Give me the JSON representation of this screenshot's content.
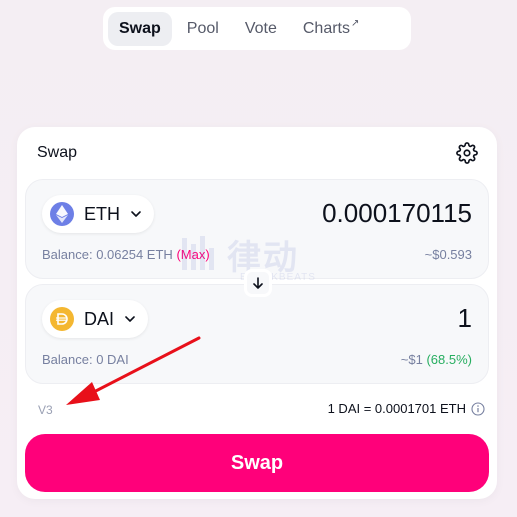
{
  "nav": {
    "items": [
      {
        "label": "Swap",
        "active": true
      },
      {
        "label": "Pool",
        "active": false
      },
      {
        "label": "Vote",
        "active": false
      },
      {
        "label": "Charts",
        "active": false,
        "external_mark": "↗"
      }
    ]
  },
  "card": {
    "title": "Swap",
    "settings_icon": "gear-icon",
    "from": {
      "token": "ETH",
      "amount": "0.000170115",
      "balance": "Balance: 0.06254 ETH",
      "max_label": "(Max)",
      "usd": "~$0.593"
    },
    "to": {
      "token": "DAI",
      "amount": "1",
      "balance": "Balance: 0 DAI",
      "usd": "~$1",
      "usd_pct": "(68.5%)"
    },
    "version": "V3",
    "rate": "1 DAI = 0.0001701 ETH",
    "swap_button": "Swap"
  },
  "watermark": {
    "text": "律动",
    "sub": "BLOCKBEATS"
  },
  "colors": {
    "accent": "#ff007a",
    "eth": "#6d7fe6",
    "dai": "#f4b731",
    "annotation_arrow": "#e8101a",
    "positive": "#27ae60"
  }
}
